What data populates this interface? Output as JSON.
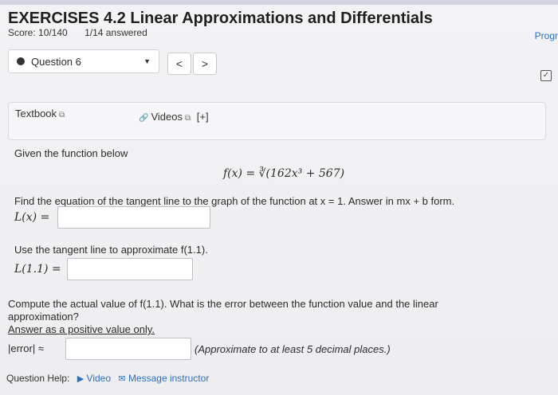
{
  "header": {
    "title": "EXERCISES 4.2 Linear Approximations and Differentials",
    "score": "Score: 10/140",
    "answered": "1/14 answered",
    "progress_link": "Progr"
  },
  "question_nav": {
    "selected": "Question 6",
    "prev_label": "<",
    "next_label": ">"
  },
  "resources": {
    "textbook": "Textbook",
    "videos": "Videos",
    "videos_more": "[+]"
  },
  "problem": {
    "intro": "Given the function below",
    "function": "f(x) = ∛(162x³ + 567)",
    "part1_prompt": "Find the equation of the tangent line to the graph of the function at x = 1. Answer in mx + b form.",
    "part1_label": "L(x) =",
    "part2_prompt": "Use the tangent line to approximate f(1.1).",
    "part2_label": "L(1.1) =",
    "part3_prompt_line1": "Compute the actual value of f(1.1). What is the error between the function value and the linear",
    "part3_prompt_line2": "approximation?",
    "part3_note": "Answer as a positive value only.",
    "part3_label": "|error| ≈",
    "part3_hint": "(Approximate to at least 5 decimal places.)"
  },
  "help": {
    "label": "Question Help:",
    "video": "Video",
    "message": "Message instructor"
  }
}
